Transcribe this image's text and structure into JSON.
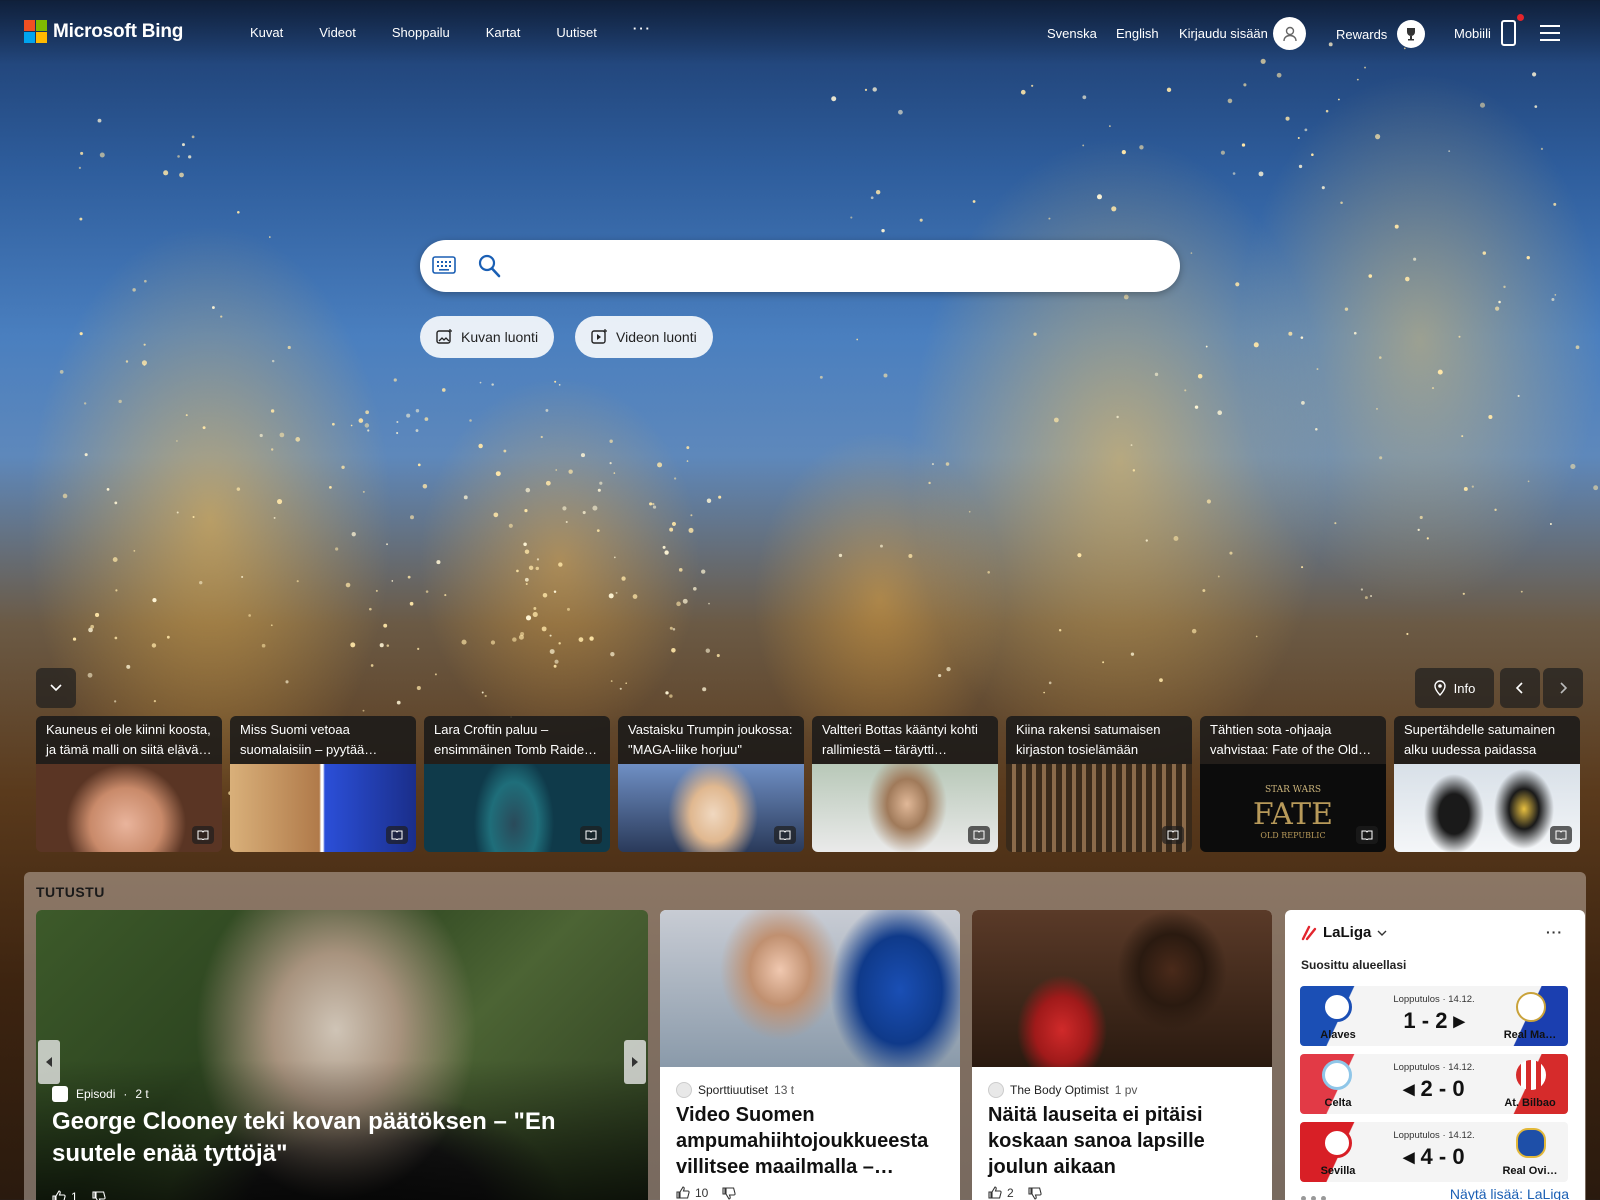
{
  "header": {
    "logo_text": "Microsoft Bing",
    "nav": [
      "Kuvat",
      "Videot",
      "Shoppailu",
      "Kartat",
      "Uutiset",
      "···"
    ],
    "lang1": "Svenska",
    "lang2": "English",
    "signin": "Kirjaudu sisään",
    "rewards": "Rewards",
    "mobile": "Mobiili"
  },
  "search": {
    "value": "",
    "placeholder": ""
  },
  "actions": {
    "image_create": "Kuvan luonti",
    "video_create": "Videon luonti"
  },
  "carousel": {
    "info": "Info",
    "items": [
      {
        "title": "Kauneus ei ole kiinni koosta, ja tämä malli on siitä elävä…"
      },
      {
        "title": "Miss Suomi vetoaa suomalaisiin – pyytää…"
      },
      {
        "title": "Lara Croftin paluu – ensimmäinen Tomb Raide…"
      },
      {
        "title": "Vastaisku Trumpin joukossa: \"MAGA-liike horjuu\""
      },
      {
        "title": "Valtteri Bottas kääntyi kohti rallimiestä – täräytti…"
      },
      {
        "title": "Kiina rakensi satumaisen kirjaston tosielämään"
      },
      {
        "title": "Tähtien sota -ohjaaja vahvistaa: Fate of the Old…"
      },
      {
        "title": "Supertähdelle satumainen alku uudessa paidassa"
      }
    ]
  },
  "explore": {
    "title": "TUTUSTU",
    "hero": {
      "source": "Episodi",
      "ago": "2 t",
      "title": "George Clooney teki kovan päätöksen – \"En suutele enää tyttöjä\"",
      "likes": "1"
    },
    "cards": [
      {
        "source": "Sporttiuutiset",
        "ago": "13 t",
        "title": "Video Suomen ampumahiihtojoukkueesta villitsee maailmalla –…",
        "likes": "10"
      },
      {
        "source": "The Body Optimist",
        "ago": "1 pv",
        "title": "Näitä lauseita ei pitäisi koskaan sanoa lapsille joulun aikaan",
        "likes": "2"
      }
    ],
    "laliga": {
      "title": "LaLiga",
      "more": "···",
      "subtitle": "Suosittu alueellasi",
      "matches": [
        {
          "status": "Lopputulos · 14.12.",
          "score": "1 - 2 ▸",
          "home": "Alaves",
          "away": "Real Ma…",
          "home_color": "#1b4fb5",
          "away_color": "#1b3fb0"
        },
        {
          "status": "Lopputulos · 14.12.",
          "score": "◂ 2 - 0",
          "home": "Celta",
          "away": "At. Bilbao",
          "home_color": "#e23a46",
          "away_color": "#d62b2b"
        },
        {
          "status": "Lopputulos · 14.12.",
          "score": "◂ 4 - 0",
          "home": "Sevilla",
          "away": "Real Ovi…",
          "home_color": "#d81f26",
          "away_color": "#ffffff"
        }
      ],
      "footer": "Näytä lisää: LaLiga"
    }
  }
}
